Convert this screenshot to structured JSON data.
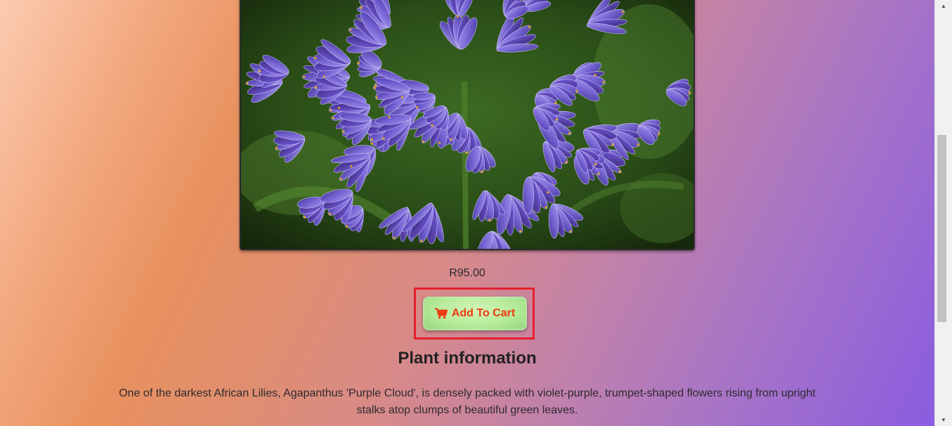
{
  "product": {
    "price": "R95.00",
    "add_to_cart_label": "Add To Cart",
    "image_subject": "Agapanthus 'Purple Cloud' flower head"
  },
  "info": {
    "title": "Plant information",
    "description": "One of the darkest African Lilies, Agapanthus 'Purple Cloud', is densely packed with violet-purple, trumpet-shaped flowers rising from upright stalks atop clumps of beautiful green leaves."
  },
  "icons": {
    "cart": "shopping-cart-icon",
    "scroll_up": "chevron-up-icon",
    "scroll_down": "chevron-down-icon"
  },
  "colors": {
    "button_text": "#ee3a12",
    "button_bg": "#b4ea98",
    "highlight": "#e5202e",
    "flower_petal": "#7a66d8",
    "foliage": "#2d5a1c"
  }
}
